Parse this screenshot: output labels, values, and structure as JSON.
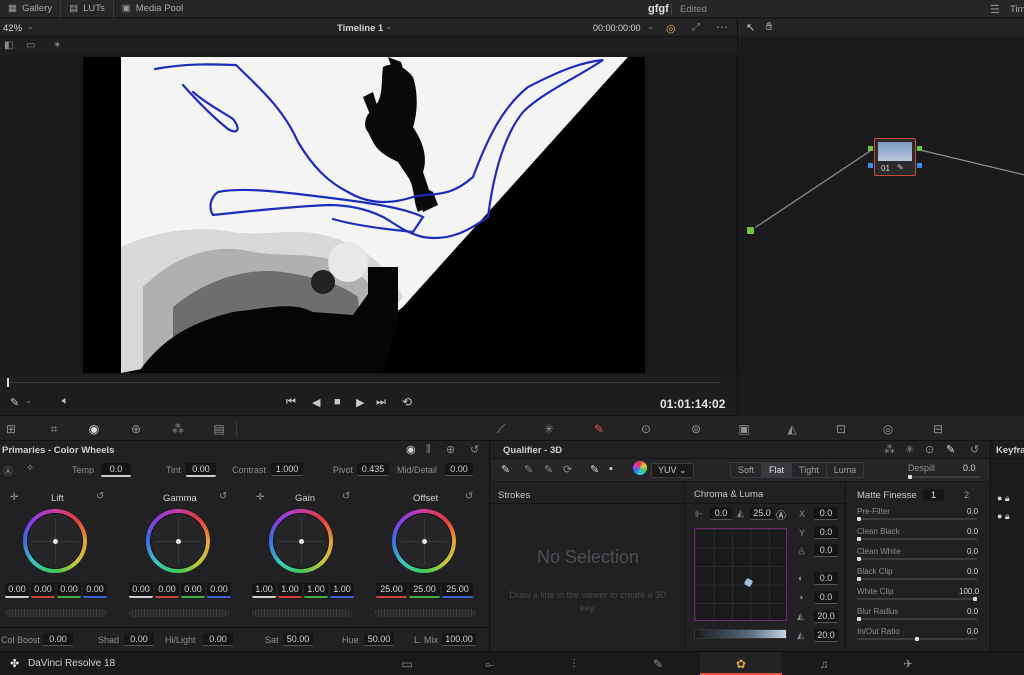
{
  "topbar": {
    "tabs": [
      {
        "label": "Gallery",
        "icon": "gallery-icon"
      },
      {
        "label": "LUTs",
        "icon": "lut-icon"
      },
      {
        "label": "Media Pool",
        "icon": "media-pool-icon"
      }
    ],
    "project_name": "gfgf",
    "project_status": "Edited",
    "right_label": "Tim"
  },
  "viewer": {
    "zoom": "42%",
    "timeline_name": "Timeline 1",
    "timecode_top": "00:00:00:00",
    "timecode": "01:01:14:02"
  },
  "node": {
    "label": "01"
  },
  "primaries": {
    "title": "Primaries - Color Wheels",
    "temp_label": "Temp",
    "temp": "0.0",
    "tint_label": "Tint",
    "tint": "0.00",
    "contrast_label": "Contrast",
    "contrast": "1.000",
    "pivot_label": "Pivot",
    "pivot": "0.435",
    "middetail_label": "Mid/Detail",
    "middetail": "0.00",
    "wheels": [
      {
        "name": "Lift",
        "values": [
          "0.00",
          "0.00",
          "0.00",
          "0.00"
        ]
      },
      {
        "name": "Gamma",
        "values": [
          "0.00",
          "0.00",
          "0.00",
          "0.00"
        ]
      },
      {
        "name": "Gain",
        "values": [
          "1.00",
          "1.00",
          "1.00",
          "1.00"
        ]
      },
      {
        "name": "Offset",
        "values": [
          "25.00",
          "25.00",
          "25.00"
        ]
      }
    ],
    "colboost_label": "Col Boost",
    "colboost": "0.00",
    "shad_label": "Shad",
    "shad": "0.00",
    "hilight_label": "Hi/Light",
    "hilight": "0.00",
    "sat_label": "Sat",
    "sat": "50.00",
    "hue_label": "Hue",
    "hue": "50.00",
    "lmix_label": "L. Mix",
    "lmix": "100.00"
  },
  "qualifier": {
    "title": "Qualifier - 3D",
    "colorspace": "YUV",
    "modes": [
      "Soft",
      "Flat",
      "Tight",
      "Luma"
    ],
    "active_mode": "Flat",
    "despill_label": "Despill",
    "despill": "0.0",
    "strokes_label": "Strokes",
    "no_selection": "No Selection",
    "hint": "Draw a line in the viewer to create a 3D key.",
    "chroma_title": "Chroma & Luma",
    "chroma_val1": "0.0",
    "chroma_val2": "25.0",
    "x_label": "X",
    "x": "0.0",
    "y_label": "Y",
    "y": "0.0",
    "z": "0.0",
    "v4": "0.0",
    "v5": "0.0",
    "v6": "20.0",
    "v7": "20.0",
    "matte_title": "Matte Finesse",
    "matte_tabs": [
      "1",
      "2"
    ],
    "matte_rows": [
      {
        "label": "Pre-Filter",
        "value": "0.0"
      },
      {
        "label": "Clean Black",
        "value": "0.0"
      },
      {
        "label": "Clean White",
        "value": "0.0"
      },
      {
        "label": "Black Clip",
        "value": "0.0"
      },
      {
        "label": "White Clip",
        "value": "100.0"
      },
      {
        "label": "Blur Radius",
        "value": "0.0"
      },
      {
        "label": "In/Out Ratio",
        "value": "0.0"
      }
    ]
  },
  "keyframes": {
    "title": "Keyfra"
  },
  "bottom": {
    "app_name": "DaVinci Resolve 18"
  },
  "colors": {
    "accent": "#e2583e",
    "stroke": "#1a2dbd"
  }
}
